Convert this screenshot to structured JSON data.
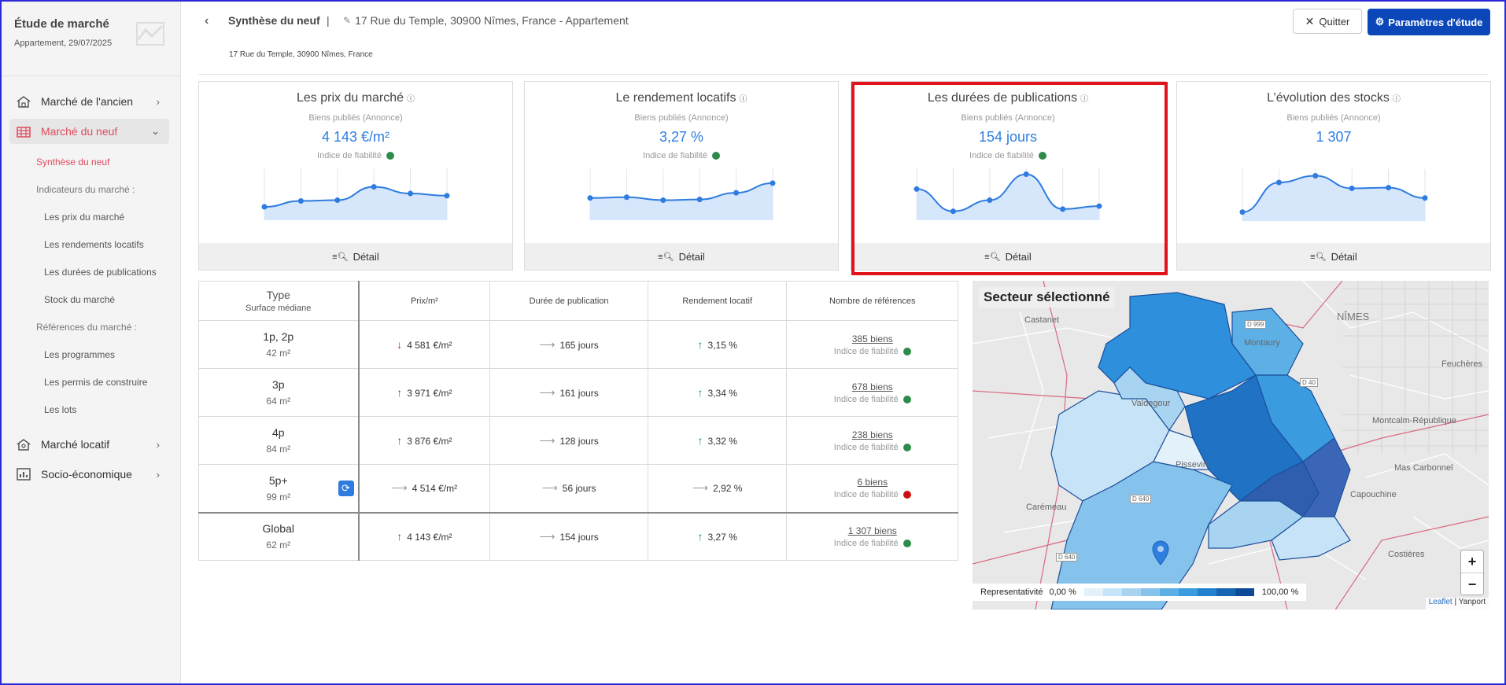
{
  "sidebar": {
    "title": "Étude de marché",
    "subtitle": "Appartement, 29/07/2025",
    "items": [
      {
        "label": "Marché de l'ancien"
      },
      {
        "label": "Marché du neuf"
      },
      {
        "label": "Marché locatif"
      },
      {
        "label": "Socio-économique"
      }
    ],
    "sublinks": {
      "synthese": "Synthèse du neuf",
      "indicateurs": "Indicateurs du marché :",
      "prix": "Les prix du marché",
      "rendements": "Les rendements locatifs",
      "durees": "Les durées de publications",
      "stock": "Stock du marché",
      "references": "Références du marché :",
      "programmes": "Les programmes",
      "permis": "Les permis de construire",
      "lots": "Les lots"
    }
  },
  "header": {
    "crumb": "Synthèse du neuf",
    "sep": "|",
    "address_title": "17 Rue du Temple, 30900 Nîmes, France - Appartement",
    "address_line": "17 Rue du Temple, 30900 Nîmes, France",
    "quit": "Quitter",
    "params": "Paramètres d'étude"
  },
  "cards": [
    {
      "title": "Les prix du marché",
      "label": "Biens publiés (Annonce)",
      "value": "4 143 €/m²",
      "fiab": "Indice de fiabilité",
      "footer": "Détail",
      "spark": [
        18,
        26,
        27,
        45,
        36,
        33
      ]
    },
    {
      "title": "Le rendement locatifs",
      "label": "Biens publiés (Annonce)",
      "value": "3,27 %",
      "fiab": "Indice de fiabilité",
      "footer": "Détail",
      "spark": [
        30,
        31,
        27,
        28,
        37,
        50
      ]
    },
    {
      "title": "Les durées de publications",
      "label": "Biens publiés (Annonce)",
      "value": "154 jours",
      "fiab": "Indice de fiabilité",
      "footer": "Détail",
      "spark": [
        42,
        12,
        27,
        62,
        15,
        19
      ]
    },
    {
      "title": "L’évolution des stocks",
      "label": "Biens publiés (Annonce)",
      "value": "1 307",
      "fiab": "",
      "footer": "Détail",
      "spark": [
        12,
        52,
        61,
        44,
        45,
        31
      ]
    }
  ],
  "table": {
    "headers": {
      "type": "Type",
      "type_sub": "Surface médiane",
      "prix": "Prix/m²",
      "duree": "Durée de publication",
      "rendement": "Rendement locatif",
      "refs": "Nombre de références"
    },
    "fiab_label": "Indice de fiabilité",
    "rows": [
      {
        "type": "1p, 2p",
        "surface": "42 m²",
        "prix": "4 581 €/m²",
        "prix_trend": "down",
        "duree": "165 jours",
        "duree_trend": "flat",
        "rendement": "3,15 %",
        "rendement_trend": "up",
        "refs": "385 biens",
        "fiab": "green"
      },
      {
        "type": "3p",
        "surface": "64 m²",
        "prix": "3 971 €/m²",
        "prix_trend": "up",
        "duree": "161 jours",
        "duree_trend": "flat",
        "rendement": "3,34 %",
        "rendement_trend": "up",
        "refs": "678 biens",
        "fiab": "green"
      },
      {
        "type": "4p",
        "surface": "84 m²",
        "prix": "3 876 €/m²",
        "prix_trend": "up",
        "duree": "128 jours",
        "duree_trend": "flat",
        "rendement": "3,32 %",
        "rendement_trend": "up",
        "refs": "238 biens",
        "fiab": "green"
      },
      {
        "type": "5p+",
        "surface": "99 m²",
        "prix": "4 514 €/m²",
        "prix_trend": "flat",
        "duree": "56 jours",
        "duree_trend": "flat",
        "rendement": "2,92 %",
        "rendement_trend": "flat",
        "refs": "6 biens",
        "fiab": "red"
      }
    ],
    "global": {
      "type": "Global",
      "surface": "62 m²",
      "prix": "4 143 €/m²",
      "prix_trend": "up",
      "duree": "154 jours",
      "duree_trend": "flat",
      "rendement": "3,27 %",
      "rendement_trend": "up",
      "refs": "1 307 biens",
      "fiab": "green"
    }
  },
  "map": {
    "title": "Secteur sélectionné",
    "city": "NÎMES",
    "places": [
      "Castanet",
      "Montaury",
      "Valdegour",
      "Pissevin",
      "Carémeau",
      "Montcalm-République",
      "Mas Carbonnel",
      "Capouchine",
      "Costières",
      "Feuchères",
      "D 999",
      "D 40",
      "D 640",
      "D 640"
    ],
    "zoom_in": "+",
    "zoom_out": "−",
    "legend_label": "Representativité",
    "legend_min": "0,00 %",
    "legend_max": "100,00 %",
    "legend_colors": [
      "#e3f1fb",
      "#c7e3f7",
      "#a8d4f2",
      "#85c3ec",
      "#5cb0e6",
      "#3a9bde",
      "#2382cf",
      "#1665b3",
      "#0d4a96"
    ],
    "attr_leaflet": "Leaflet",
    "attr_sep": " | ",
    "attr_src": "Yanport"
  },
  "colors": {
    "accent": "#e04a5e",
    "primary": "#0b47b8",
    "value": "#2e7ce0",
    "highlight": "#e0121a"
  }
}
